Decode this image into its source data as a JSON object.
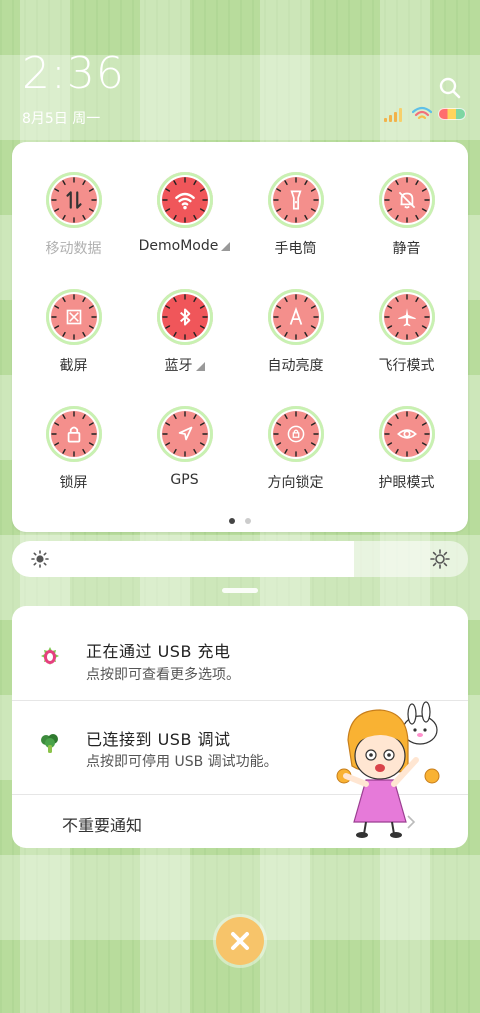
{
  "status": {
    "time": "2:36",
    "date": "8月5日 周一"
  },
  "quick_settings": {
    "tiles": [
      {
        "label": "移动数据",
        "icon": "mobile-data-icon",
        "active": false,
        "dim": true,
        "has_arrow": false
      },
      {
        "label": "DemoMode",
        "icon": "wifi-icon",
        "active": true,
        "dim": false,
        "has_arrow": true
      },
      {
        "label": "手电筒",
        "icon": "flashlight-icon",
        "active": false,
        "dim": false,
        "has_arrow": false
      },
      {
        "label": "静音",
        "icon": "bell-mute-icon",
        "active": false,
        "dim": false,
        "has_arrow": false
      },
      {
        "label": "截屏",
        "icon": "screenshot-icon",
        "active": false,
        "dim": false,
        "has_arrow": false
      },
      {
        "label": "蓝牙",
        "icon": "bluetooth-icon",
        "active": true,
        "dim": false,
        "has_arrow": true
      },
      {
        "label": "自动亮度",
        "icon": "auto-brightness-icon",
        "active": false,
        "dim": false,
        "has_arrow": false
      },
      {
        "label": "飞行模式",
        "icon": "airplane-icon",
        "active": false,
        "dim": false,
        "has_arrow": false
      },
      {
        "label": "锁屏",
        "icon": "lock-icon",
        "active": false,
        "dim": false,
        "has_arrow": false
      },
      {
        "label": "GPS",
        "icon": "gps-icon",
        "active": false,
        "dim": false,
        "has_arrow": false
      },
      {
        "label": "方向锁定",
        "icon": "rotation-lock-icon",
        "active": false,
        "dim": false,
        "has_arrow": false
      },
      {
        "label": "护眼模式",
        "icon": "eye-icon",
        "active": false,
        "dim": false,
        "has_arrow": false
      }
    ],
    "page_indicator": {
      "current": 1,
      "total": 2
    }
  },
  "brightness": {
    "level": 0.75
  },
  "notifications": [
    {
      "title": "正在通过  USB  充电",
      "body": "点按即可查看更多选项。",
      "icon": "dragonfruit-icon"
    },
    {
      "title": "已连接到  USB  调试",
      "body": "点按即可停用 USB 调试功能。",
      "icon": "broccoli-icon"
    }
  ],
  "unimportant_label": "不重要通知",
  "colors": {
    "melon": "#f48f8c",
    "melon_active": "#f0565a",
    "rind": "#c8f1b2",
    "clear_button": "#f7c46a"
  }
}
